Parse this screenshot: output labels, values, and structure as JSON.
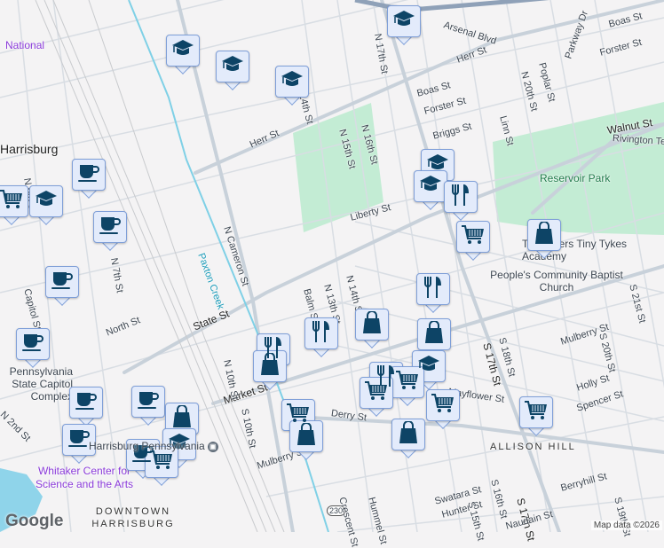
{
  "map": {
    "streets": [
      "N Cameron St",
      "Herr St",
      "Arsenal Blvd",
      "N 17th St",
      "Boas St",
      "Forster St",
      "Parkway Dr",
      "N 20th St",
      "Poplar St",
      "Linn St",
      "Walnut St",
      "Rivington Ter",
      "N 16th St",
      "N 15th St",
      "14th St",
      "Briggs St",
      "Liberty St",
      "State St",
      "North St",
      "Capitol St",
      "N 2nd St",
      "Market St",
      "N 10th St",
      "S 10th St",
      "Mulberry St",
      "Derry St",
      "S 17th St",
      "S 18th St",
      "S 20th St",
      "Holly St",
      "Spencer St",
      "Mayflower St",
      "Swatara St",
      "Hunter St",
      "S 15th St",
      "S 16th St",
      "Naudain St",
      "Berryhill St",
      "S 19th St",
      "Crescent St",
      "Hummel St",
      "Balm St",
      "N 13th St",
      "N 14th St",
      "S 21st St",
      "Paxton Creek",
      "N 6th St",
      "N 7th St"
    ],
    "places": {
      "harrisburg": "Harrisburg",
      "national": "National",
      "capitol": "Pennsylvania State Capitol Complex",
      "whitaker": "Whitaker Center for Science and the Arts",
      "reservoir": "Reservoir Park",
      "church": "People's Community Baptist Church",
      "academy": "Tiny Tigers Tiny Tykes Academy",
      "downtown": "DOWNTOWN HARRISBURG",
      "allison": "ALLISON HILL",
      "route": "230",
      "harrisburg_station": "Harrisburg Pennsylvania"
    },
    "markers": [
      "school",
      "school",
      "school",
      "school",
      "cafe",
      "grocery",
      "school",
      "cafe",
      "cafe",
      "cafe",
      "school",
      "school",
      "restaurant",
      "grocery",
      "shopping",
      "restaurant",
      "restaurant",
      "shopping",
      "shopping",
      "restaurant",
      "shopping",
      "school",
      "restaurant",
      "grocery",
      "grocery",
      "grocery",
      "shopping",
      "grocery",
      "cafe",
      "cafe",
      "shopping",
      "cafe",
      "cafe",
      "school",
      "grocery",
      "grocery",
      "shopping"
    ],
    "colors": {
      "marker_bg": "#e3ebfb",
      "marker_icon": "#0d4466",
      "park": "#c3ecd4",
      "water": "#8fd4ea"
    }
  },
  "footer": {
    "logo": "Google",
    "attribution": "Map data ©2026"
  }
}
